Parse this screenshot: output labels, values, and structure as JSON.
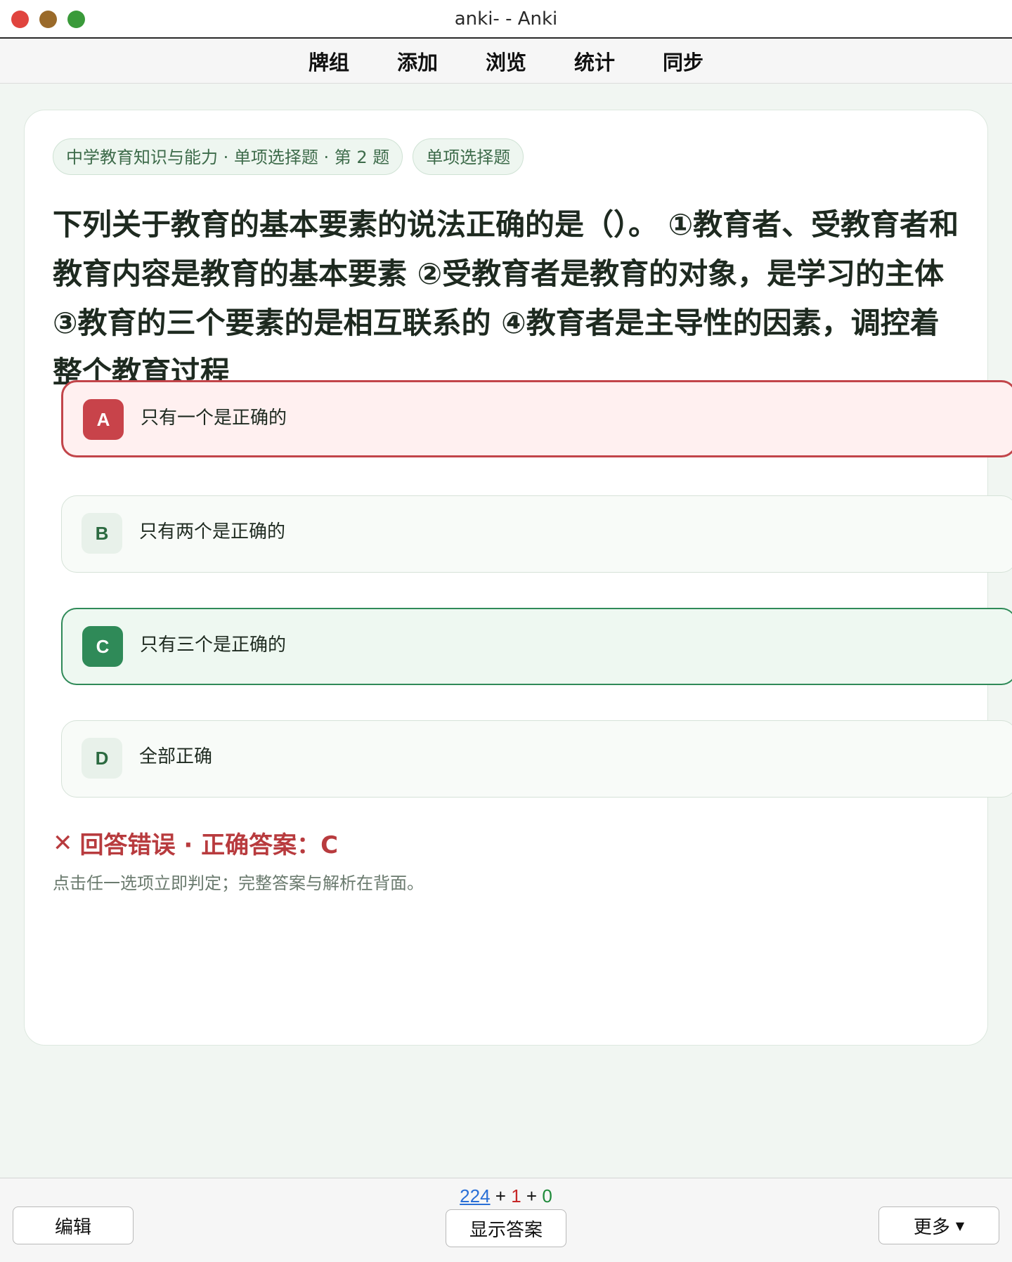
{
  "window": {
    "title": "anki- - Anki"
  },
  "menu": {
    "items": [
      "牌组",
      "添加",
      "浏览",
      "统计",
      "同步"
    ]
  },
  "card": {
    "tags": [
      "中学教育知识与能力 · 单项选择题 · 第 2 题",
      "单项选择题"
    ],
    "question": "下列关于教育的基本要素的说法正确的是（）。 ①教育者、受教育者和教育内容是教育的基本要素 ②受教育者是教育的对象，是学习的主体 ③教育的三个要素的是相互联系的 ④教育者是主导性的因素，调控着整个教育过程",
    "options": [
      {
        "letter": "A",
        "text": "只有一个是正确的",
        "state": "wrong"
      },
      {
        "letter": "B",
        "text": "只有两个是正确的",
        "state": "normal"
      },
      {
        "letter": "C",
        "text": "只有三个是正确的",
        "state": "correct"
      },
      {
        "letter": "D",
        "text": "全部正确",
        "state": "normal"
      }
    ],
    "verdict_icon": "✕",
    "verdict": "回答错误 · 正确答案：C",
    "hint": "点击任一选项立即判定；完整答案与解析在背面。"
  },
  "bottom": {
    "counts": {
      "new": "224",
      "plus1": "+",
      "learn": "1",
      "plus2": "+",
      "review": "0"
    },
    "edit_label": "编辑",
    "show_answer_label": "显示答案",
    "more_label": "更多",
    "more_icon": "caret-down-icon"
  },
  "colors": {
    "wrong": "#c2454a",
    "correct": "#2f8a58",
    "background": "#f1f6f2"
  }
}
